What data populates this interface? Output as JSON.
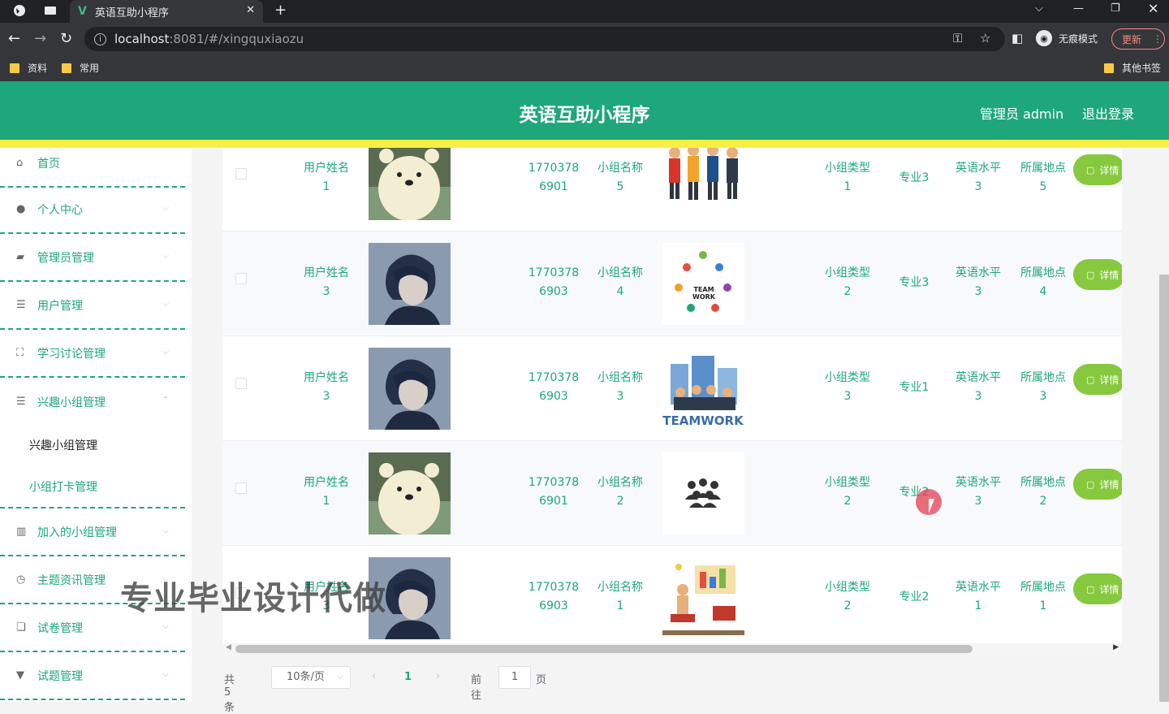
{
  "browser": {
    "tab_title": "英语互助小程序",
    "url_host": "localhost",
    "url_path": ":8081/#/xingquxiaozu",
    "incognito_label": "无痕模式",
    "update_label": "更新",
    "bookmarks": [
      "资料",
      "常用"
    ],
    "other_bookmarks": "其他书签"
  },
  "header": {
    "title": "英语互助小程序",
    "admin_label": "管理员 admin",
    "logout_label": "退出登录"
  },
  "sidebar": {
    "items": [
      {
        "label": "首页",
        "icon": "home-icon"
      },
      {
        "label": "个人中心",
        "icon": "user-icon"
      },
      {
        "label": "管理员管理",
        "icon": "admin-icon"
      },
      {
        "label": "用户管理",
        "icon": "list-icon"
      },
      {
        "label": "学习讨论管理",
        "icon": "frame-icon"
      },
      {
        "label": "兴趣小组管理",
        "icon": "list-icon"
      },
      {
        "label": "加入的小组管理",
        "icon": "library-icon"
      },
      {
        "label": "主题资讯管理",
        "icon": "clock-icon"
      },
      {
        "label": "试卷管理",
        "icon": "copy-icon"
      },
      {
        "label": "试题管理",
        "icon": "cup-icon"
      }
    ],
    "subitems": [
      "兴趣小组管理",
      "小组打卡管理"
    ]
  },
  "table": {
    "detail_label": "详情",
    "rows": [
      {
        "name": "用户姓名",
        "name_n": "1",
        "phone1": "1770378",
        "phone2": "6901",
        "group": "小组名称",
        "group_n": "5",
        "type": "小组类型",
        "type_n": "1",
        "major": "专业3",
        "level": "英语水平",
        "level_n": "3",
        "loc": "所属地点",
        "loc_n": "5",
        "avatar": "bear"
      },
      {
        "name": "用户姓名",
        "name_n": "3",
        "phone1": "1770378",
        "phone2": "6903",
        "group": "小组名称",
        "group_n": "4",
        "type": "小组类型",
        "type_n": "2",
        "major": "专业3",
        "level": "英语水平",
        "level_n": "3",
        "loc": "所属地点",
        "loc_n": "4",
        "avatar": "boy"
      },
      {
        "name": "用户姓名",
        "name_n": "3",
        "phone1": "1770378",
        "phone2": "6903",
        "group": "小组名称",
        "group_n": "3",
        "type": "小组类型",
        "type_n": "3",
        "major": "专业1",
        "level": "英语水平",
        "level_n": "3",
        "loc": "所属地点",
        "loc_n": "3",
        "avatar": "boy",
        "group_caption": "TEAMWORK"
      },
      {
        "name": "用户姓名",
        "name_n": "1",
        "phone1": "1770378",
        "phone2": "6901",
        "group": "小组名称",
        "group_n": "2",
        "type": "小组类型",
        "type_n": "2",
        "major": "专业2",
        "level": "英语水平",
        "level_n": "3",
        "loc": "所属地点",
        "loc_n": "2",
        "avatar": "bear"
      },
      {
        "name": "用户姓名",
        "name_n": "3",
        "phone1": "1770378",
        "phone2": "6903",
        "group": "小组名称",
        "group_n": "1",
        "type": "小组类型",
        "type_n": "2",
        "major": "专业2",
        "level": "英语水平",
        "level_n": "1",
        "loc": "所属地点",
        "loc_n": "1",
        "avatar": "boy"
      }
    ]
  },
  "pagination": {
    "total": "共 5 条",
    "page_size": "10条/页",
    "current": "1",
    "goto_label": "前往",
    "goto_value": "1",
    "page_suffix": "页"
  },
  "watermark": "专业毕业设计代做",
  "colors": {
    "accent": "#1ea77a",
    "header_stripe": "#f7ef45",
    "detail_button": "#86c93e"
  }
}
